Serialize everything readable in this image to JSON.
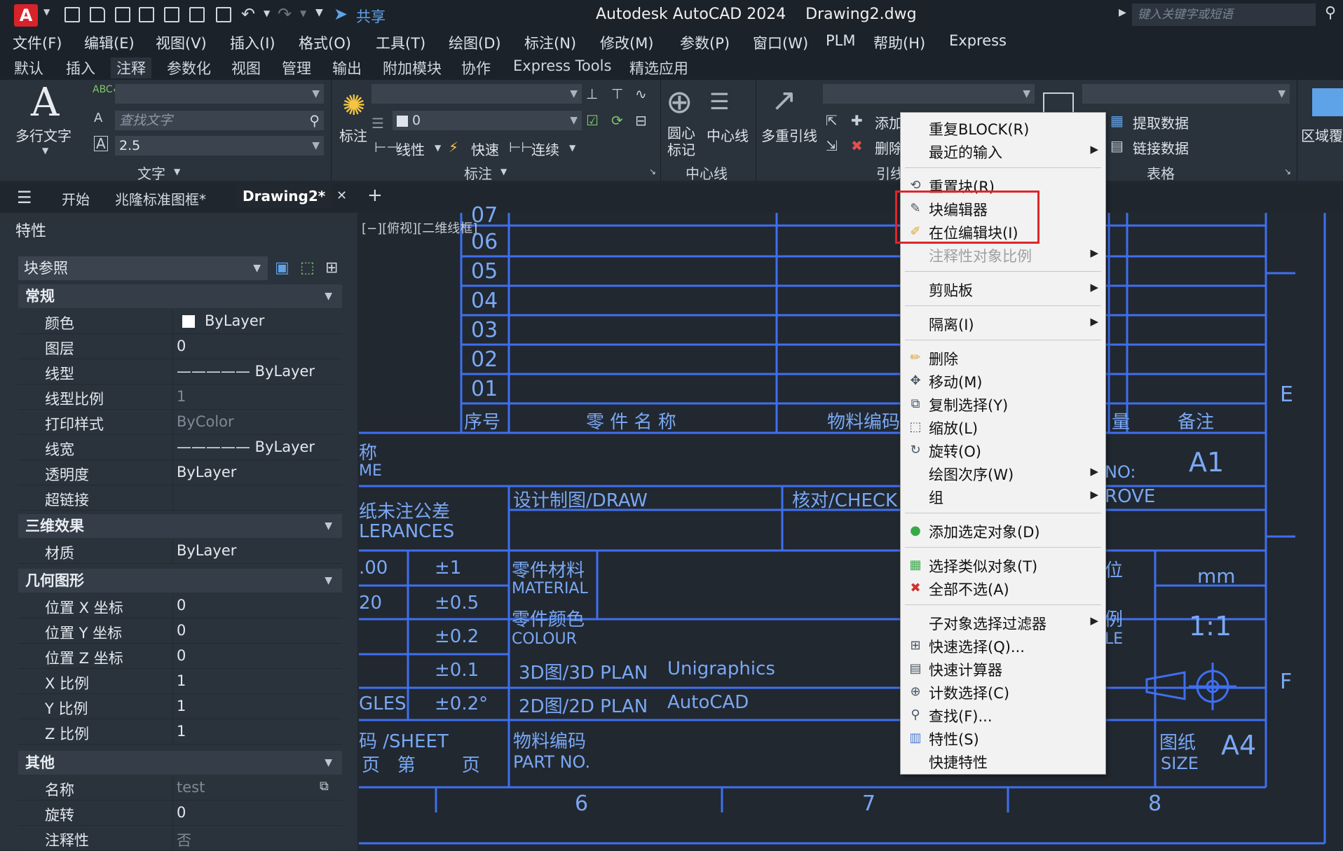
{
  "titlebar": {
    "app_letter": "A",
    "share": "共享",
    "title": "Autodesk AutoCAD 2024    Drawing2.dwg",
    "search_placeholder": "键入关键字或短语"
  },
  "menubar": [
    "文件(F)",
    "编辑(E)",
    "视图(V)",
    "插入(I)",
    "格式(O)",
    "工具(T)",
    "绘图(D)",
    "标注(N)",
    "修改(M)",
    "参数(P)",
    "窗口(W)",
    "PLM",
    "帮助(H)",
    "Express"
  ],
  "ribbon_tabs": [
    "默认",
    "插入",
    "注释",
    "参数化",
    "视图",
    "管理",
    "输出",
    "附加模块",
    "协作",
    "Express Tools",
    "精选应用"
  ],
  "ribbon": {
    "mtext": "多行文字",
    "find_text": "查找文字",
    "text_height": "2.5",
    "group_text": "文字",
    "dim": "标注",
    "linear": "线性",
    "quick": "快速",
    "continue": "连续",
    "dim_layer_value": "0",
    "group_dim": "标注",
    "center_mark": "圆心\n标记",
    "centerline": "中心线",
    "group_centerline": "中心线",
    "mleader": "多重引线",
    "add": "添加",
    "remove": "删除",
    "group_leader": "引线",
    "extract": "提取数据",
    "link": "链接数据",
    "group_table": "表格",
    "region": "区域覆"
  },
  "filetabs": {
    "start": "开始",
    "tab1": "兆隆标准图框*",
    "tab2": "Drawing2*"
  },
  "properties": {
    "title": "特性",
    "object_type": "块参照",
    "sections": {
      "general": "常规",
      "3d": "三维效果",
      "geometry": "几何图形",
      "misc": "其他"
    },
    "general_rows": [
      {
        "key": "颜色",
        "value": "ByLayer"
      },
      {
        "key": "图层",
        "value": "0"
      },
      {
        "key": "线型",
        "value": "————— ByLayer"
      },
      {
        "key": "线型比例",
        "value": "1"
      },
      {
        "key": "打印样式",
        "value": "ByColor"
      },
      {
        "key": "线宽",
        "value": "————— ByLayer"
      },
      {
        "key": "透明度",
        "value": "ByLayer"
      },
      {
        "key": "超链接",
        "value": ""
      }
    ],
    "d3_rows": [
      {
        "key": "材质",
        "value": "ByLayer"
      }
    ],
    "geometry_rows": [
      {
        "key": "位置 X 坐标",
        "value": "0"
      },
      {
        "key": "位置 Y 坐标",
        "value": "0"
      },
      {
        "key": "位置 Z 坐标",
        "value": "0"
      },
      {
        "key": "X 比例",
        "value": "1"
      },
      {
        "key": "Y 比例",
        "value": "1"
      },
      {
        "key": "Z 比例",
        "value": "1"
      }
    ],
    "misc_rows": [
      {
        "key": "名称",
        "value": "test"
      },
      {
        "key": "旋转",
        "value": "0"
      },
      {
        "key": "注释性",
        "value": "否"
      }
    ]
  },
  "drawing": {
    "view_label": "[−][俯视][二维线框]",
    "row_numbers": [
      "07",
      "06",
      "05",
      "04",
      "03",
      "02",
      "01"
    ],
    "bom_header": {
      "seq": "序号",
      "name": "零 件 名 称",
      "code": "物料编码",
      "qty": "量",
      "remark": "备注"
    },
    "zone_e": "E",
    "zone_f": "F",
    "title_a": "称",
    "title_b": "ME",
    "no_label": "NO:",
    "sheet_a1": "A1",
    "tol_title": "纸未注公差",
    "tol_title_en": "LERANCES",
    "draw": "设计制图/DRAW",
    "check": "核对/CHECK",
    "approve": "ROVE",
    "tol_rows": [
      {
        "range": ".00",
        "tol": "±1"
      },
      {
        "range": "20",
        "tol": "±0.5"
      },
      {
        "range": "",
        "tol": "±0.2"
      },
      {
        "range": "",
        "tol": "±0.1"
      },
      {
        "range": "GLES",
        "tol": "±0.2°"
      }
    ],
    "material": "零件材料",
    "material_en": "MATERIAL",
    "colour": "零件颜色",
    "colour_en": "COLOUR",
    "unit_label": "位",
    "unit_value": "mm",
    "scale_label": "例",
    "scale_label_en": "LE",
    "scale_value": "1:1",
    "plan3d": "3D图/3D PLAN",
    "plan3d_sw": "Unigraphics",
    "plan2d": "2D图/2D PLAN",
    "plan2d_sw": "AutoCAD",
    "sheet_no": "码 /SHEET",
    "page": "页   第        页",
    "part_no": "物料编码",
    "part_no_en": "PART NO.",
    "paper": "图纸",
    "paper_en": "SIZE",
    "paper_size": "A4",
    "col_numbers": [
      "6",
      "7",
      "8"
    ]
  },
  "context_menu": [
    {
      "label": "重复BLOCK(R)",
      "icon": "",
      "submenu": false
    },
    {
      "label": "最近的输入",
      "icon": "",
      "submenu": true
    },
    {
      "sep": true
    },
    {
      "label": "重置块(R)",
      "icon": "reset-block-icon",
      "submenu": false
    },
    {
      "label": "块编辑器",
      "icon": "block-editor-icon",
      "submenu": false
    },
    {
      "label": "在位编辑块(I)",
      "icon": "edit-in-place-icon",
      "submenu": false
    },
    {
      "label": "注释性对象比例",
      "icon": "",
      "submenu": true,
      "disabled": true
    },
    {
      "sep": true
    },
    {
      "label": "剪贴板",
      "icon": "",
      "submenu": true
    },
    {
      "sep": true
    },
    {
      "label": "隔离(I)",
      "icon": "",
      "submenu": true
    },
    {
      "sep": true
    },
    {
      "label": "删除",
      "icon": "erase-icon",
      "submenu": false
    },
    {
      "label": "移动(M)",
      "icon": "move-icon",
      "submenu": false
    },
    {
      "label": "复制选择(Y)",
      "icon": "copy-icon",
      "submenu": false
    },
    {
      "label": "缩放(L)",
      "icon": "scale-icon",
      "submenu": false
    },
    {
      "label": "旋转(O)",
      "icon": "rotate-icon",
      "submenu": false
    },
    {
      "label": "绘图次序(W)",
      "icon": "",
      "submenu": true
    },
    {
      "label": "组",
      "icon": "",
      "submenu": true
    },
    {
      "sep": true
    },
    {
      "label": "添加选定对象(D)",
      "icon": "add-selected-icon",
      "submenu": false
    },
    {
      "sep": true
    },
    {
      "label": "选择类似对象(T)",
      "icon": "select-similar-icon",
      "submenu": false
    },
    {
      "label": "全部不选(A)",
      "icon": "deselect-all-icon",
      "submenu": false
    },
    {
      "sep": true
    },
    {
      "label": "子对象选择过滤器",
      "icon": "",
      "submenu": true
    },
    {
      "label": "快速选择(Q)...",
      "icon": "quick-select-icon",
      "submenu": false
    },
    {
      "label": "快速计算器",
      "icon": "calculator-icon",
      "submenu": false
    },
    {
      "label": "计数选择(C)",
      "icon": "count-icon",
      "submenu": false
    },
    {
      "label": "查找(F)...",
      "icon": "find-icon",
      "submenu": false
    },
    {
      "label": "特性(S)",
      "icon": "properties-icon",
      "submenu": false
    },
    {
      "label": "快捷特性",
      "icon": "",
      "submenu": false
    }
  ],
  "colors": {
    "accent_red": "#e0252b",
    "drawing_blue": "#3f6ff0",
    "drawing_text": "#7aa8f5"
  }
}
